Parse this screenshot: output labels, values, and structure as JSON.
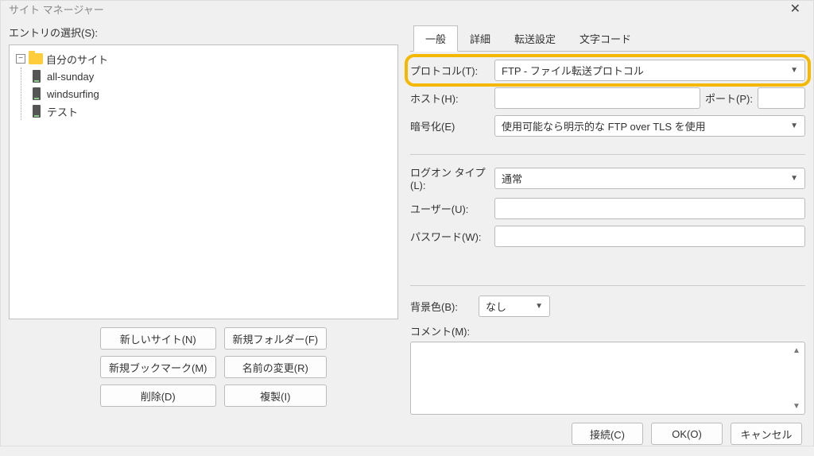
{
  "window": {
    "title": "サイト マネージャー"
  },
  "left": {
    "entry_label": "エントリの選択(S):",
    "root_label": "自分のサイト",
    "sites": [
      {
        "label": "all-sunday"
      },
      {
        "label": "windsurfing"
      },
      {
        "label": "テスト"
      }
    ],
    "buttons": {
      "new_site": "新しいサイト(N)",
      "new_folder": "新規フォルダー(F)",
      "new_bookmark": "新規ブックマーク(M)",
      "rename": "名前の変更(R)",
      "delete": "削除(D)",
      "duplicate": "複製(I)"
    }
  },
  "tabs": {
    "general": "一般",
    "advanced": "詳細",
    "transfer": "転送設定",
    "charset": "文字コード"
  },
  "form": {
    "protocol_label": "プロトコル(T):",
    "protocol_value": "FTP - ファイル転送プロトコル",
    "host_label": "ホスト(H):",
    "port_label": "ポート(P):",
    "encryption_label": "暗号化(E)",
    "encryption_value": "使用可能なら明示的な FTP over TLS を使用",
    "logon_label": "ログオン タイプ(L):",
    "logon_value": "通常",
    "user_label": "ユーザー(U):",
    "password_label": "パスワード(W):",
    "bgcolor_label": "背景色(B):",
    "bgcolor_value": "なし",
    "comment_label": "コメント(M):"
  },
  "footer": {
    "connect": "接続(C)",
    "ok": "OK(O)",
    "cancel": "キャンセル"
  }
}
